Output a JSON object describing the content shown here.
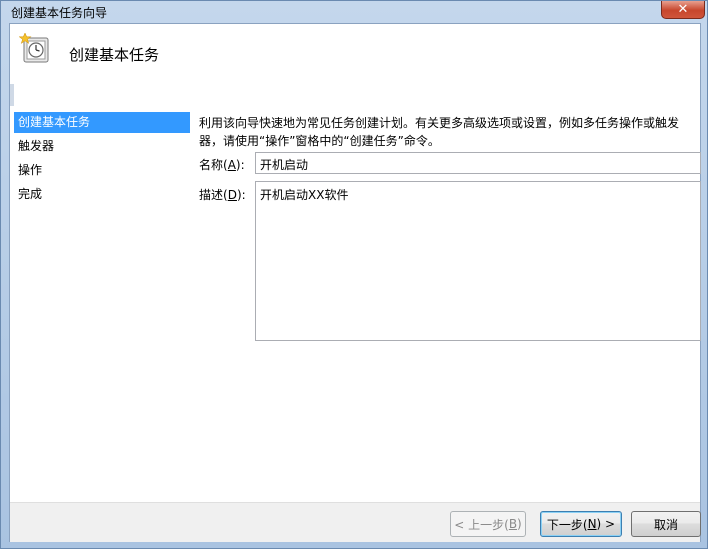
{
  "window": {
    "title": "创建基本任务向导",
    "close_glyph": "✕"
  },
  "header": {
    "title": "创建基本任务",
    "icon": "clock-star-icon"
  },
  "nav": {
    "items": [
      {
        "label": "创建基本任务"
      },
      {
        "label": "触发器"
      },
      {
        "label": "操作"
      },
      {
        "label": "完成"
      }
    ]
  },
  "main": {
    "description": "利用该向导快速地为常见任务创建计划。有关更多高级选项或设置，例如多任务操作或触发器，请使用“操作”窗格中的“创建任务”命令。",
    "name_label_pre": "名称(",
    "name_label_key": "A",
    "name_label_post": "):",
    "name_value": "开机启动",
    "desc_label_pre": "描述(",
    "desc_label_key": "D",
    "desc_label_post": "):",
    "desc_value": "开机启动XX软件"
  },
  "footer": {
    "back_pre": "< 上一步(",
    "back_key": "B",
    "back_post": ")",
    "next_pre": "下一步(",
    "next_key": "N",
    "next_post": ") >",
    "cancel_label": "取消"
  },
  "colors": {
    "selection": "#3399ff",
    "frame": "#b9d1ea"
  }
}
